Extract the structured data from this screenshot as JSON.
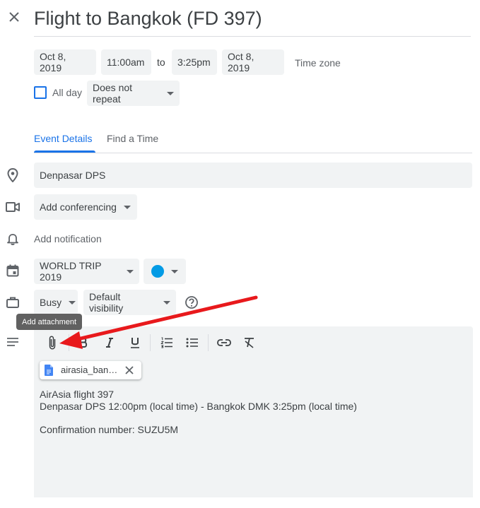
{
  "event": {
    "title": "Flight to Bangkok (FD 397)",
    "start_date": "Oct 8, 2019",
    "start_time": "11:00am",
    "to_label": "to",
    "end_time": "3:25pm",
    "end_date": "Oct 8, 2019",
    "time_zone_label": "Time zone",
    "all_day_label": "All day",
    "repeat": "Does not repeat"
  },
  "tabs": [
    {
      "label": "Event Details",
      "active": true
    },
    {
      "label": "Find a Time",
      "active": false
    }
  ],
  "details": {
    "location": "Denpasar DPS",
    "conferencing": "Add conferencing",
    "notification": "Add notification",
    "calendar": "WORLD TRIP 2019",
    "event_color": "#039be5",
    "availability": "Busy",
    "visibility": "Default visibility"
  },
  "tooltip": {
    "text": "Add attachment"
  },
  "attachment": {
    "name": "airasia_ban…"
  },
  "description": {
    "lines": [
      "AirAsia flight 397",
      "Denpasar DPS 12:00pm (local time) - Bangkok DMK 3:25pm (local time)",
      "",
      "Confirmation number: SUZU5M"
    ]
  },
  "colors": {
    "accent": "#1a73e8",
    "annotation_arrow": "#e8191c",
    "field_bg": "#f1f3f4"
  }
}
